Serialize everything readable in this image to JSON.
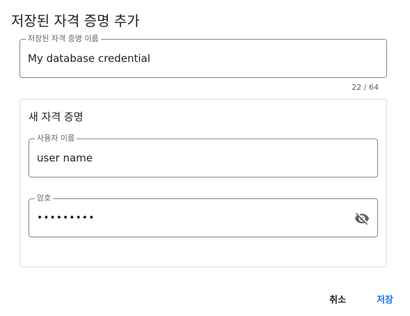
{
  "dialog": {
    "title": "저장된 자격 증명 추가"
  },
  "credential_name_field": {
    "label": "저장된 자격 증명 이름",
    "value": "My database credential",
    "counter": "22 / 64"
  },
  "new_credential": {
    "heading": "새 자격 증명",
    "username_field": {
      "label": "사용자 이름",
      "value": "user name"
    },
    "password_field": {
      "label": "암호",
      "value": "•••••••••",
      "toggle_icon": "visibility-off-icon"
    }
  },
  "actions": {
    "cancel_label": "취소",
    "save_label": "저장"
  },
  "colors": {
    "primary": "#1a73e8",
    "text": "#202124",
    "secondary_text": "#5f6368",
    "border": "#80868b",
    "card_border": "#dadce0"
  }
}
